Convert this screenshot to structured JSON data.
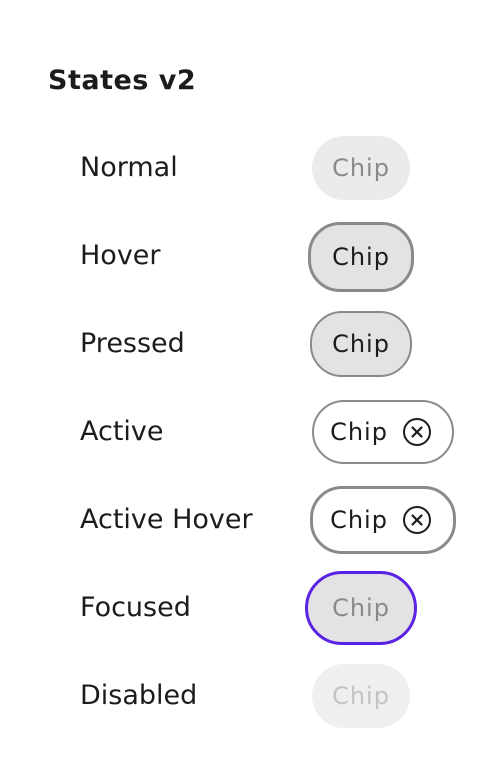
{
  "header": {
    "title": "States v2"
  },
  "states": [
    {
      "label": "Normal",
      "chip": "Chip"
    },
    {
      "label": "Hover",
      "chip": "Chip"
    },
    {
      "label": "Pressed",
      "chip": "Chip"
    },
    {
      "label": "Active",
      "chip": "Chip",
      "icon": "close-circle-icon"
    },
    {
      "label": "Active Hover",
      "chip": "Chip",
      "icon": "close-circle-icon"
    },
    {
      "label": "Focused",
      "chip": "Chip"
    },
    {
      "label": "Disabled",
      "chip": "Chip"
    }
  ],
  "colors": {
    "text": "#1c1c1c",
    "chip_fill": "#ebebeb",
    "chip_fill_pressed": "#e3e3e3",
    "chip_border": "#8a8a8a",
    "focus_ring": "#5a22e3",
    "disabled_text": "#c4c4c4"
  }
}
